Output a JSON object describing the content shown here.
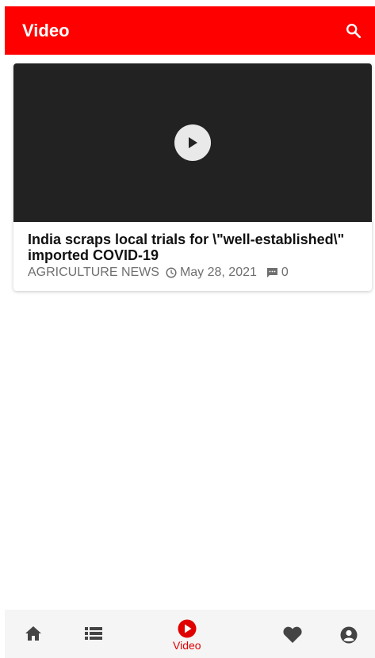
{
  "app_bar": {
    "title": "Video",
    "background": "#fe0000",
    "search_icon": "search-icon"
  },
  "posts": [
    {
      "title": "India scraps local trials for \\\"well-established\\\" imported COVID-19",
      "category": "AGRICULTURE NEWS",
      "date": "May 28, 2021",
      "comments": "0",
      "thumbnail_icon": "play-icon"
    }
  ],
  "bottom_nav": {
    "items": [
      {
        "icon": "home-icon",
        "label": ""
      },
      {
        "icon": "list-icon",
        "label": ""
      },
      {
        "icon": "video-play-icon",
        "label": "Video",
        "active": true
      },
      {
        "icon": "heart-icon",
        "label": ""
      },
      {
        "icon": "account-icon",
        "label": ""
      }
    ],
    "active_color": "#e00000",
    "inactive_color": "#444444"
  }
}
